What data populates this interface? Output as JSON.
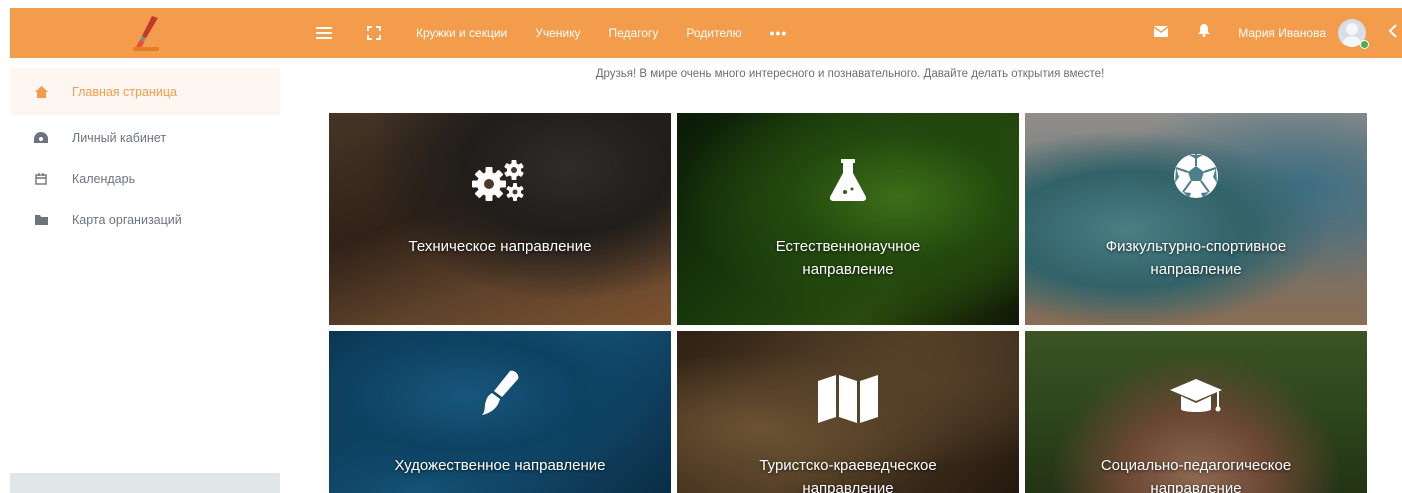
{
  "header": {
    "nav_links": [
      "Кружки и секции",
      "Ученику",
      "Педагогу",
      "Родителю"
    ],
    "more_label": "•••",
    "user_name": "Мария Иванова",
    "accent_color": "#f39c4b"
  },
  "sidebar": {
    "items": [
      {
        "label": "Главная страница",
        "icon": "home-icon",
        "active": true
      },
      {
        "label": "Личный кабинет",
        "icon": "dashboard-icon",
        "active": false
      },
      {
        "label": "Календарь",
        "icon": "calendar-icon",
        "active": false
      },
      {
        "label": "Карта организаций",
        "icon": "folder-icon",
        "active": false
      }
    ]
  },
  "main": {
    "welcome_text": "Друзья! В мире очень много интересного и познавательного. Давайте делать открытия вместе!",
    "tiles": [
      {
        "line1": "Техническое направление",
        "line2": "",
        "icon": "gears-icon"
      },
      {
        "line1": "Естественнонаучное",
        "line2": "направление",
        "icon": "flask-icon"
      },
      {
        "line1": "Физкультурно-спортивное",
        "line2": "направление",
        "icon": "soccer-ball-icon"
      },
      {
        "line1": "Художественное направление",
        "line2": "",
        "icon": "paint-brush-icon"
      },
      {
        "line1": "Туристско-краеведческое",
        "line2": "направление",
        "icon": "map-icon"
      },
      {
        "line1": "Социально-педагогическое",
        "line2": "направление",
        "icon": "graduation-cap-icon"
      }
    ]
  }
}
